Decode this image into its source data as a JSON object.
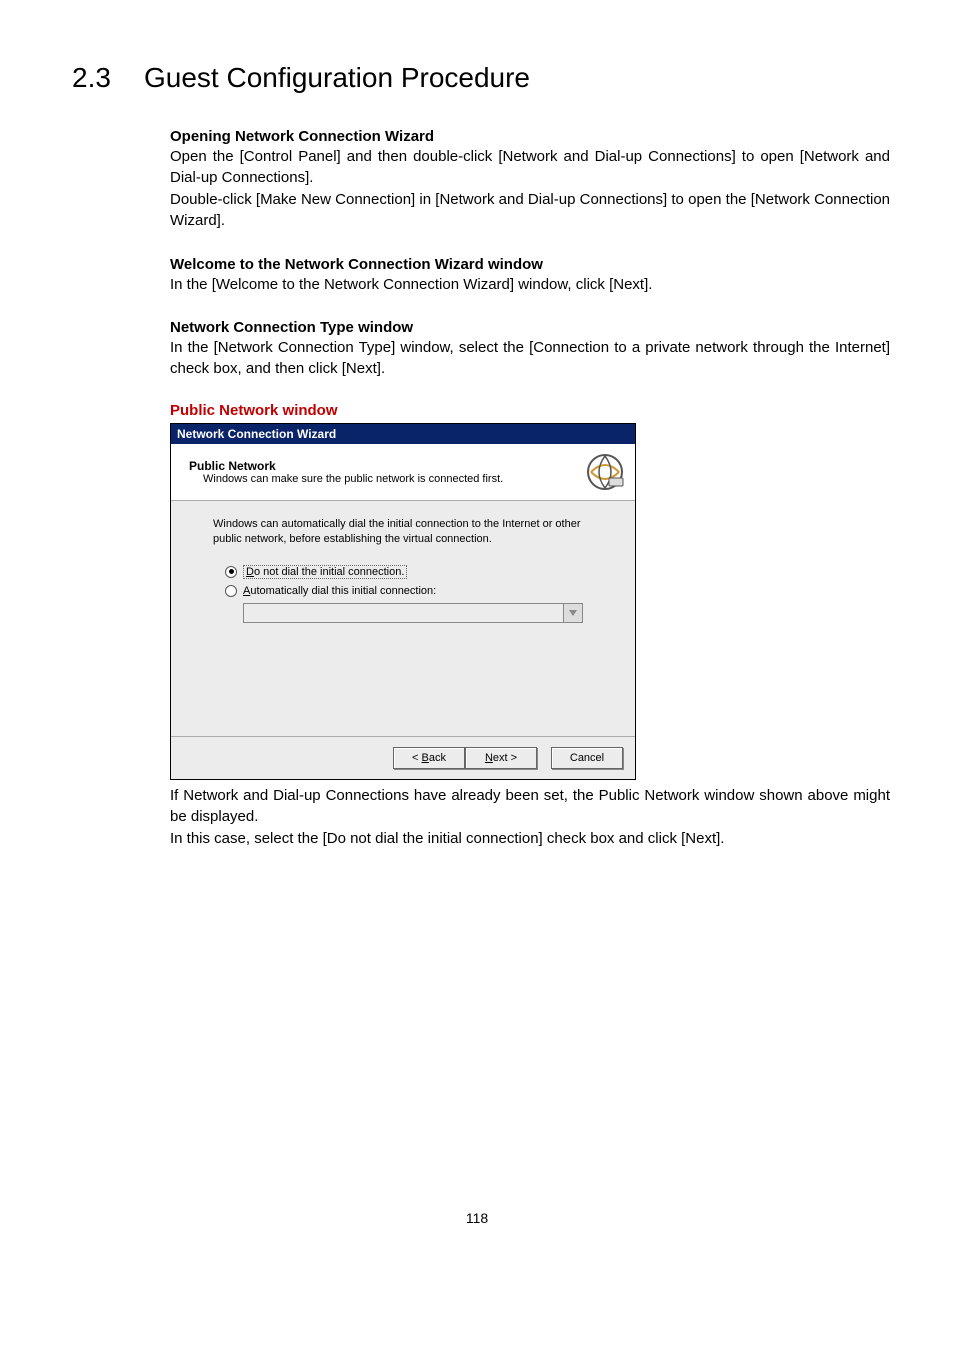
{
  "section": {
    "number": "2.3",
    "title": "Guest Configuration Procedure"
  },
  "blocks": {
    "opening": {
      "heading": "Opening Network Connection Wizard",
      "p1": "Open the [Control Panel] and then double-click [Network and Dial-up Connections] to open [Network and Dial-up Connections].",
      "p2": "Double-click [Make New Connection] in [Network and Dial-up Connections] to open the [Network Connection Wizard]."
    },
    "welcome": {
      "heading": "Welcome to the Network Connection Wizard window",
      "p1": "In the [Welcome to the Network Connection Wizard] window, click [Next]."
    },
    "type": {
      "heading": "Network Connection Type window",
      "p1": "In the [Network Connection Type] window, select the [Connection to a private network through the Internet] check box, and then click [Next]."
    },
    "public": {
      "heading": "Public Network window",
      "after1": "If Network and Dial-up Connections have already been set, the Public Network window shown above might be displayed.",
      "after2": "In this case, select the [Do not dial the initial connection] check box and click [Next]."
    }
  },
  "wizard": {
    "titlebar": "Network Connection Wizard",
    "header_title": "Public Network",
    "header_sub": "Windows can make sure the public network is connected first.",
    "intro": "Windows can automatically dial the initial connection to the Internet or other public network, before establishing the virtual connection.",
    "radio1_prefix": "D",
    "radio1_rest": "o not dial the initial connection.",
    "radio2_prefix": "A",
    "radio2_rest": "utomatically dial this initial connection:",
    "btn_back_prefix": "< ",
    "btn_back_u": "B",
    "btn_back_rest": "ack",
    "btn_next_u": "N",
    "btn_next_rest": "ext >",
    "btn_cancel": "Cancel"
  },
  "page_number": "118"
}
